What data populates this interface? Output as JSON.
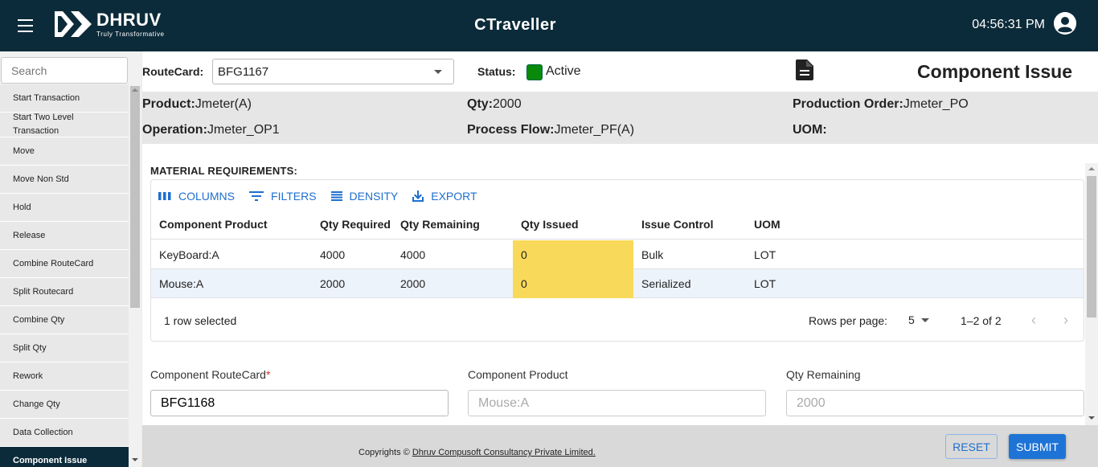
{
  "header": {
    "brand_name": "DHRUV",
    "brand_tagline": "Truly Transformative",
    "app_title": "CTraveller",
    "clock": "04:56:31 PM"
  },
  "sidebar": {
    "search_placeholder": "Search",
    "items": [
      {
        "label": "Start Transaction"
      },
      {
        "label": "Start Two Level Transaction"
      },
      {
        "label": "Move"
      },
      {
        "label": "Move Non Std"
      },
      {
        "label": "Hold"
      },
      {
        "label": "Release"
      },
      {
        "label": "Combine RouteCard"
      },
      {
        "label": "Split Routecard"
      },
      {
        "label": "Combine Qty"
      },
      {
        "label": "Split Qty"
      },
      {
        "label": "Rework"
      },
      {
        "label": "Change Qty"
      },
      {
        "label": "Data Collection"
      },
      {
        "label": "Component Issue"
      }
    ],
    "active": "Component Issue"
  },
  "form_top": {
    "routecard_label": "RouteCard:",
    "routecard_value": "BFG1167",
    "status_label": "Status:",
    "status_value": "Active",
    "status_color": "#0a8a0a",
    "page_title": "Component Issue"
  },
  "info": {
    "product_label": "Product:",
    "product_value": "Jmeter(A)",
    "qty_label": "Qty:",
    "qty_value": "2000",
    "prod_order_label": "Production Order:",
    "prod_order_value": "Jmeter_PO",
    "operation_label": "Operation:",
    "operation_value": "Jmeter_OP1",
    "process_flow_label": "Process Flow:",
    "process_flow_value": "Jmeter_PF(A)",
    "uom_label": "UOM:",
    "uom_value": ""
  },
  "material": {
    "title": "MATERIAL REQUIREMENTS:",
    "toolbar": {
      "columns": "COLUMNS",
      "filters": "FILTERS",
      "density": "DENSITY",
      "export": "EXPORT"
    },
    "headers": [
      "Component Product",
      "Qty Required",
      "Qty Remaining",
      "Qty Issued",
      "Issue Control",
      "UOM"
    ],
    "rows": [
      {
        "product": "KeyBoard:A",
        "required": "4000",
        "remaining": "4000",
        "issued": "0",
        "control": "Bulk",
        "uom": "LOT",
        "selected": false
      },
      {
        "product": "Mouse:A",
        "required": "2000",
        "remaining": "2000",
        "issued": "0",
        "control": "Serialized",
        "uom": "LOT",
        "selected": true
      }
    ],
    "selected_text": "1 row selected",
    "rows_per_page_label": "Rows per page:",
    "rows_per_page": "5",
    "range": "1–2 of 2",
    "highlight_color": "#f9d95a"
  },
  "fields": {
    "comp_routecard_label": "Component RouteCard",
    "comp_routecard_required": "*",
    "comp_routecard_value": "BFG1168",
    "comp_product_label": "Component Product",
    "comp_product_value": "Mouse:A",
    "qty_remaining_label": "Qty Remaining",
    "qty_remaining_value": "2000"
  },
  "footer": {
    "copyright_prefix": "Copyrights ©",
    "company": "Dhruv Compusoft Consultancy Private Limited.",
    "reset_label": "RESET",
    "submit_label": "SUBMIT"
  }
}
